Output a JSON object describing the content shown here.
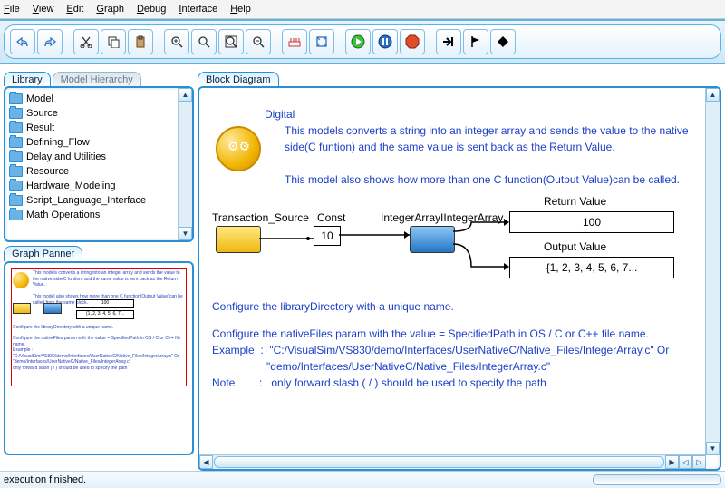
{
  "menu": {
    "file": "File",
    "view": "View",
    "edit": "Edit",
    "graph": "Graph",
    "debug": "Debug",
    "interface": "Interface",
    "help": "Help"
  },
  "tabs": {
    "library": "Library",
    "model_hierarchy": "Model Hierarchy",
    "block_diagram": "Block Diagram",
    "graph_panner": "Graph Panner"
  },
  "library_items": [
    "Model",
    "Source",
    "Result",
    "Defining_Flow",
    "Delay and Utilities",
    "Resource",
    "Hardware_Modeling",
    "Script_Language_Interface",
    "Math Operations"
  ],
  "diagram": {
    "digital_label": "Digital",
    "desc1": "This models converts a string into an integer array and sends the value to the native side(C funtion) and the same value is sent back as the Return Value.",
    "desc2": "This model also shows how more than one C function(Output Value)can be called.",
    "transaction_source": "Transaction_Source",
    "const_label": "Const",
    "const_value": "10",
    "integer_array": "IntegerArrayIIntegerArray",
    "return_value_label": "Return Value",
    "return_value": "100",
    "output_value_label": "Output Value",
    "output_value": "{1, 2, 3, 4, 5, 6, 7...",
    "config1": "Configure the libraryDirectory with a unique name.",
    "config2": "Configure the nativeFiles param with the value = SpecifiedPath in OS / C or C++ file name.",
    "example_label": "Example  :",
    "example1": "\"C:/VisualSim/VS830/demo/Interfaces/UserNativeC/Native_Files/IntegerArray.c\" Or",
    "example2": "\"demo/Interfaces/UserNativeC/Native_Files/IntegerArray.c\"",
    "note_label": "Note        :",
    "note": "only forward slash ( / ) should be used to specify the path"
  },
  "status": {
    "text": "execution finished."
  }
}
